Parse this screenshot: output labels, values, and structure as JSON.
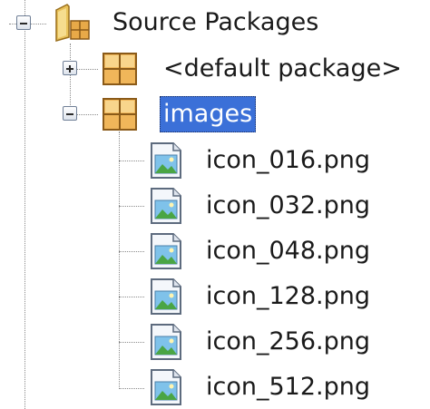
{
  "tree": {
    "root": {
      "label": "Source Packages",
      "icon": "source-packages-icon",
      "expanded": true
    },
    "packages": [
      {
        "label": "<default package>",
        "icon": "package-icon",
        "expanded": false,
        "selected": false
      },
      {
        "label": "images",
        "icon": "package-icon",
        "expanded": true,
        "selected": true
      }
    ],
    "files": [
      {
        "label": "icon_016.png",
        "icon": "image-file-icon"
      },
      {
        "label": "icon_032.png",
        "icon": "image-file-icon"
      },
      {
        "label": "icon_048.png",
        "icon": "image-file-icon"
      },
      {
        "label": "icon_128.png",
        "icon": "image-file-icon"
      },
      {
        "label": "icon_256.png",
        "icon": "image-file-icon"
      },
      {
        "label": "icon_512.png",
        "icon": "image-file-icon"
      }
    ]
  },
  "colors": {
    "selection": "#3b70d8",
    "package": "#e8a948",
    "folder": "#e9c25a",
    "tree_lines": "#8a8a8a"
  }
}
